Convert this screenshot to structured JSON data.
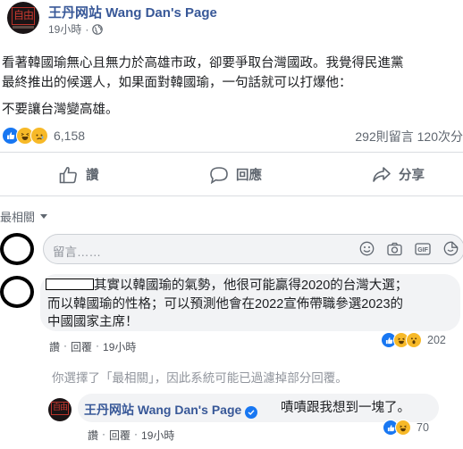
{
  "header": {
    "page_name": "王丹网站 Wang Dan's Page",
    "time": "19小時",
    "separator": "·",
    "avatar_logo": "自由"
  },
  "post": {
    "lines": [
      "看著韓國瑜無心且無力於高雄市政，卻要爭取台灣國政。我覺得民進黨",
      "最終推出的候選人，如果面對韓國瑜，一句話就可以打爆他：",
      "不要讓台灣變高雄。"
    ]
  },
  "reactions": {
    "count": "6,158",
    "comments_shares": "292則留言  120次分"
  },
  "actions": {
    "like": "讚",
    "comment": "回應",
    "share": "分享"
  },
  "comments": {
    "filter_label": "最相關",
    "input_placeholder": "留言……",
    "comment1": {
      "line1": "其實以韓國瑜的氣勢，他很可能贏得2020的台灣大選；",
      "line2": "而以韓國瑜的性格；可以預測他會在2022宣佈帶職參選2023的",
      "line3": "中國國家主席！",
      "like": "讚",
      "dot": "·",
      "reply": "回覆",
      "time": "19小時",
      "react_count": "202"
    },
    "notice": "你選擇了「最相關」，因此系統可能已過濾掉部分回覆。",
    "reply1": {
      "author": "王丹网站 Wang Dan's Page",
      "text": "嘖嘖跟我想到一塊了。",
      "like": "讚",
      "dot": "·",
      "reply": "回覆",
      "time": "19小時",
      "react_count": "70"
    }
  },
  "colors": {
    "link": "#385898",
    "like_blue": "#1877f2",
    "emoji_yellow": "#f7b928",
    "bubble": "#f2f3f5"
  }
}
